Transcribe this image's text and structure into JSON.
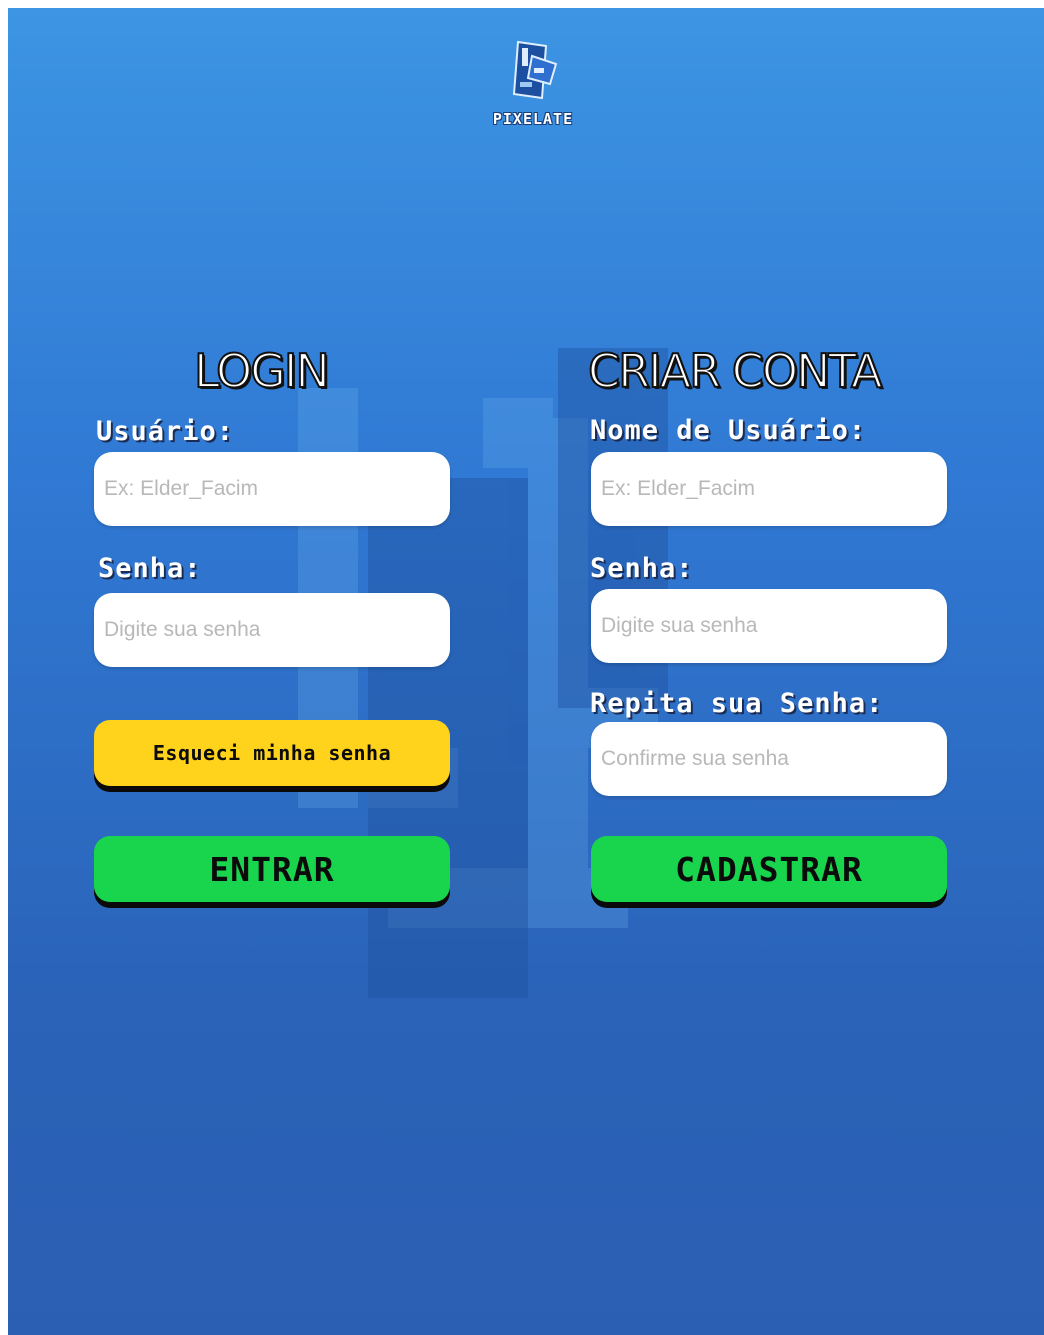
{
  "brand": {
    "name": "PIXELATE"
  },
  "colors": {
    "primary_button": "#19d44d",
    "secondary_button": "#ffd21c",
    "background_top": "#3d95e3",
    "background_bottom": "#2b5fb3"
  },
  "login": {
    "title": "LOGIN",
    "username_label": "Usuário:",
    "username_placeholder": "Ex: Elder_Facim",
    "password_label": "Senha:",
    "password_placeholder": "Digite sua senha",
    "forgot_label": "Esqueci minha senha",
    "submit_label": "ENTRAR"
  },
  "register": {
    "title": "CRIAR CONTA",
    "username_label": "Nome de Usuário:",
    "username_placeholder": "Ex: Elder_Facim",
    "password_label": "Senha:",
    "password_placeholder": "Digite sua senha",
    "confirm_label": "Repita sua Senha:",
    "confirm_placeholder": "Confirme sua senha",
    "submit_label": "CADASTRAR"
  }
}
